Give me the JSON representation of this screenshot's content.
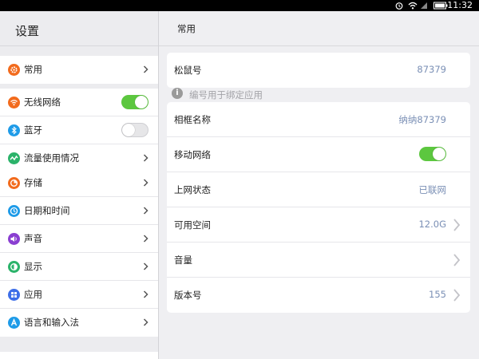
{
  "status_bar": {
    "time": "11:32"
  },
  "left": {
    "title": "设置",
    "groups": [
      {
        "items": [
          {
            "label": "常用",
            "icon": "gear-icon",
            "color": "#f26b1d"
          }
        ]
      },
      {
        "items": [
          {
            "label": "无线网络",
            "icon": "wifi-icon",
            "color": "#f26b1d",
            "toggle": "on"
          },
          {
            "label": "蓝牙",
            "icon": "bluetooth-icon",
            "color": "#1e9be8",
            "toggle": "off"
          },
          {
            "label": "流量使用情况",
            "icon": "data-usage-icon",
            "color": "#2bb36a"
          }
        ]
      },
      {
        "items": [
          {
            "label": "存储",
            "icon": "storage-icon",
            "color": "#f26b1d"
          },
          {
            "label": "日期和时间",
            "icon": "clock-icon",
            "color": "#1e9be8"
          },
          {
            "label": "声音",
            "icon": "sound-icon",
            "color": "#8a3fd1"
          },
          {
            "label": "显示",
            "icon": "display-icon",
            "color": "#2bb36a"
          },
          {
            "label": "应用",
            "icon": "apps-icon",
            "color": "#3d6ee8"
          },
          {
            "label": "语言和输入法",
            "icon": "language-icon",
            "color": "#1e9be8"
          }
        ]
      }
    ]
  },
  "right": {
    "title": "常用",
    "mouse_card": {
      "label": "松鼠号",
      "value": "87379"
    },
    "hint": "编号用于绑定应用",
    "rows": [
      {
        "label": "相框名称",
        "value": "纳纳87379"
      },
      {
        "label": "移动网络",
        "toggle": "on"
      },
      {
        "label": "上网状态",
        "value": "已联网"
      },
      {
        "label": "可用空间",
        "value": "12.0G",
        "chevron": true
      },
      {
        "label": "音量",
        "value": "",
        "chevron": true
      },
      {
        "label": "版本号",
        "value": "155",
        "chevron": true
      }
    ]
  },
  "colors": {
    "toggle_on": "#5cc73f",
    "value_text": "#7a8fb5"
  }
}
